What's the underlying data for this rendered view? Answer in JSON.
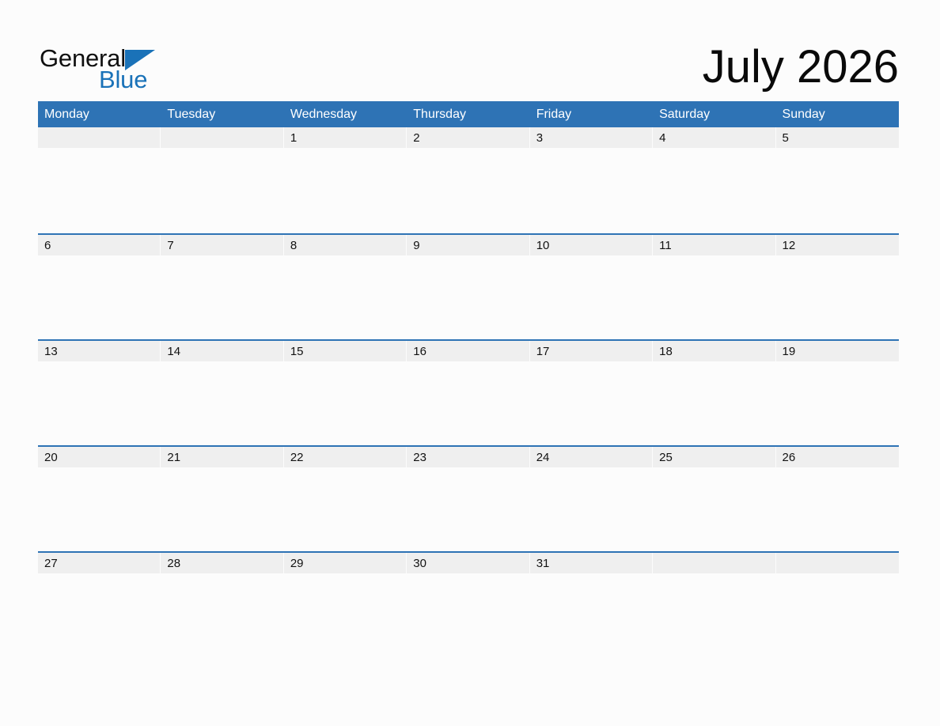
{
  "brand": {
    "name_part1": "General",
    "name_part2": "Blue",
    "accent_color": "#1a72b8"
  },
  "header": {
    "title": "July 2026"
  },
  "calendar": {
    "month": "July",
    "year": "2026",
    "header_color": "#2e73b5",
    "date_band_color": "#efefef",
    "page_background": "#fcfcfc",
    "weekdays": [
      "Monday",
      "Tuesday",
      "Wednesday",
      "Thursday",
      "Friday",
      "Saturday",
      "Sunday"
    ],
    "weeks": [
      {
        "days": [
          "",
          "",
          "1",
          "2",
          "3",
          "4",
          "5"
        ]
      },
      {
        "days": [
          "6",
          "7",
          "8",
          "9",
          "10",
          "11",
          "12"
        ]
      },
      {
        "days": [
          "13",
          "14",
          "15",
          "16",
          "17",
          "18",
          "19"
        ]
      },
      {
        "days": [
          "20",
          "21",
          "22",
          "23",
          "24",
          "25",
          "26"
        ]
      },
      {
        "days": [
          "27",
          "28",
          "29",
          "30",
          "31",
          "",
          ""
        ]
      }
    ]
  }
}
